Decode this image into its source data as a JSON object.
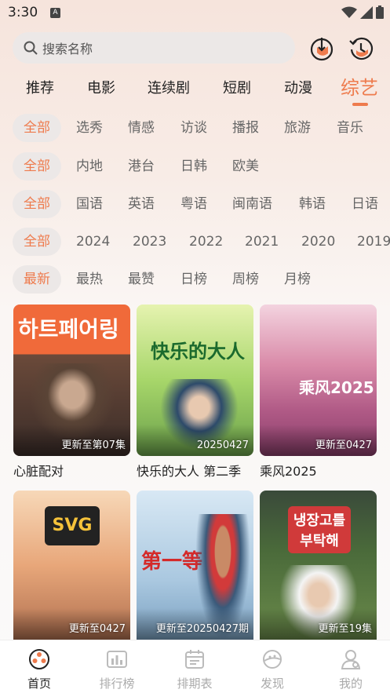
{
  "status": {
    "time": "3:30"
  },
  "search": {
    "placeholder": "搜索名称"
  },
  "tabs": [
    {
      "label": "推荐"
    },
    {
      "label": "电影"
    },
    {
      "label": "连续剧"
    },
    {
      "label": "短剧"
    },
    {
      "label": "动漫"
    },
    {
      "label": "综艺"
    }
  ],
  "filters": {
    "genre": [
      "全部",
      "选秀",
      "情感",
      "访谈",
      "播报",
      "旅游",
      "音乐"
    ],
    "region": [
      "全部",
      "内地",
      "港台",
      "日韩",
      "欧美"
    ],
    "language": [
      "全部",
      "国语",
      "英语",
      "粤语",
      "闽南语",
      "韩语",
      "日语"
    ],
    "year": [
      "全部",
      "2024",
      "2023",
      "2022",
      "2021",
      "2020",
      "2019"
    ],
    "sort": [
      "最新",
      "最热",
      "最赞",
      "日榜",
      "周榜",
      "月榜"
    ]
  },
  "cards": [
    {
      "title": "心脏配对",
      "badge": "更新至第07集",
      "poster_text": "하트페어링"
    },
    {
      "title": "快乐的大人 第二季",
      "badge": "20250427",
      "poster_text": "快乐的大人"
    },
    {
      "title": "乘风2025",
      "badge": "更新至0427",
      "poster_text": "乘风2025"
    },
    {
      "title": "",
      "badge": "更新至0427",
      "poster_text": "SVG"
    },
    {
      "title": "",
      "badge": "更新至20250427期",
      "poster_text": "第一等"
    },
    {
      "title": "",
      "badge": "更新至19集",
      "poster_text": "냉장고를 부탁해"
    }
  ],
  "nav": [
    {
      "label": "首页"
    },
    {
      "label": "排行榜"
    },
    {
      "label": "排期表"
    },
    {
      "label": "发现"
    },
    {
      "label": "我的"
    }
  ],
  "colors": {
    "accent": "#ee7b4d"
  }
}
